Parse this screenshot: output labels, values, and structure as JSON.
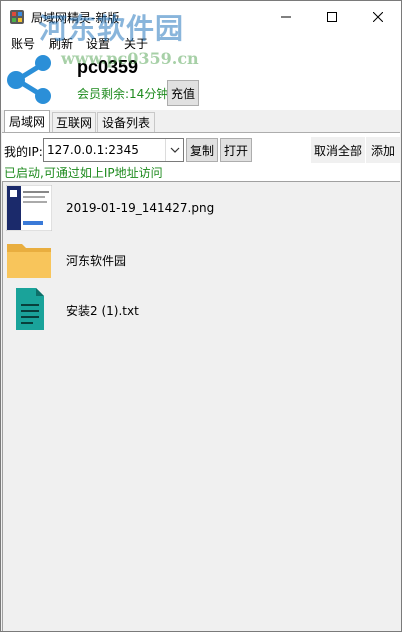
{
  "window": {
    "title": "局域网精灵-新版"
  },
  "watermark": {
    "main": "河东软件园",
    "url": "www.pc0359.cn"
  },
  "menu": {
    "items": [
      "账号",
      "刷新",
      "设置",
      "关于"
    ]
  },
  "account": {
    "username": "pc0359",
    "membership": "会员剩余:14分钟",
    "recharge_label": "充值"
  },
  "tabs": [
    {
      "label": "局域网",
      "active": true
    },
    {
      "label": "互联网",
      "active": false
    },
    {
      "label": "设备列表",
      "active": false
    }
  ],
  "lan": {
    "ip_label": "我的IP:",
    "ip_value": "127.0.0.1:2345",
    "copy_label": "复制",
    "open_label": "打开",
    "cancel_all_label": "取消全部",
    "add_label": "添加",
    "status": "已启动,可通过如上IP地址访问"
  },
  "files": [
    {
      "name": "2019-01-19_141427.png",
      "icon": "image-thumbnail-icon"
    },
    {
      "name": "河东软件园",
      "icon": "folder-icon"
    },
    {
      "name": "安装2 (1).txt",
      "icon": "text-file-icon"
    }
  ],
  "colors": {
    "status_green": "#1d8a1d",
    "share_logo_blue": "#2b8fd8",
    "folder_yellow": "#f8c55b",
    "txt_teal": "#1aa39a"
  }
}
